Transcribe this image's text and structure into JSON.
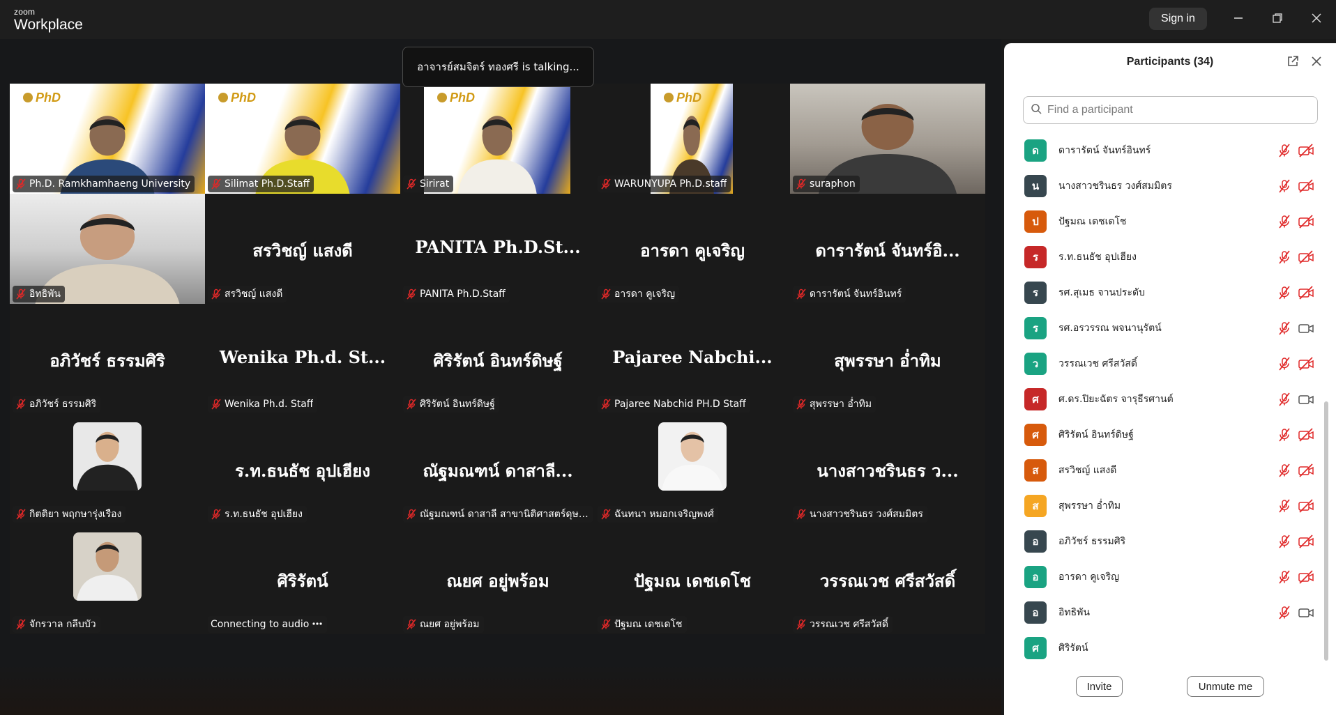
{
  "app": {
    "brand_top": "zoom",
    "brand_main": "Workplace",
    "signin_label": "Sign in"
  },
  "toast": {
    "text": "อาจารย์สมจิตร์  ทองศรี is talking..."
  },
  "tiles": [
    {
      "label": "Ph.D. Ramkhamhaeng University",
      "type": "video",
      "video": "phd",
      "muted": true
    },
    {
      "label": "Silimat Ph.D.Staff",
      "type": "video",
      "video": "phd",
      "muted": true
    },
    {
      "label": "Sirirat",
      "type": "video",
      "video": "phd",
      "muted": true
    },
    {
      "label": "WARUNYUPA Ph.D.staff",
      "type": "video",
      "video": "phd",
      "muted": true
    },
    {
      "label": "suraphon",
      "type": "video",
      "video": "office",
      "muted": true
    },
    {
      "label": "อิทธิพัน",
      "type": "video",
      "video": "room",
      "muted": true
    },
    {
      "big": "สรวิชญ์  แสงดี",
      "label": "สรวิชญ์  แสงดี",
      "type": "name",
      "muted": true
    },
    {
      "big": "PANITA  Ph.D.St...",
      "label": "PANITA Ph.D.Staff",
      "type": "name",
      "muted": true
    },
    {
      "big": "อารดา คูเจริญ",
      "label": "อารดา คูเจริญ",
      "type": "name",
      "muted": true
    },
    {
      "big": "ดารารัตน์ จันทร์อิ...",
      "label": "ดารารัตน์ จันทร์อินทร์",
      "type": "name",
      "muted": true
    },
    {
      "big": "อภิวัชร์ ธรรมศิริ",
      "label": "อภิวัชร์ ธรรมศิริ",
      "type": "name",
      "muted": true
    },
    {
      "big": "Wenika  Ph.d.  St...",
      "label": "Wenika Ph.d. Staff",
      "type": "name",
      "muted": true
    },
    {
      "big": "ศิริรัตน์ อินทร์ดิษฐ์",
      "label": "ศิริรัตน์ อินทร์ดิษฐ์",
      "type": "name",
      "muted": true
    },
    {
      "big": "Pajaree  Nabchi...",
      "label": "Pajaree Nabchid PH.D Staff",
      "type": "name",
      "muted": true
    },
    {
      "big": "สุพรรษา อ่ำทิม",
      "label": "สุพรรษา อ่ำทิม",
      "type": "name",
      "muted": true
    },
    {
      "label": "กิตติยา พฤกษารุ่งเรือง",
      "type": "avatar",
      "avatar": "woman-suit",
      "muted": true
    },
    {
      "big": "ร.ท.ธนธัช  อุปเฮียง",
      "label": "ร.ท.ธนธัช  อุปเฮียง",
      "type": "name",
      "muted": true
    },
    {
      "big": "ณัฐมณฑน์ ดาสาลี...",
      "label": "ณัฐมณฑน์ ดาสาลี สาขานิติศาสตร์ดุษฎี...",
      "type": "name",
      "muted": true
    },
    {
      "label": "ฉันทนา หมอกเจริญพงศ์",
      "type": "avatar",
      "avatar": "woman-white",
      "muted": true
    },
    {
      "big": "นางสาวชรินธร ว...",
      "label": "นางสาวชรินธร วงศ์สมมิตร",
      "type": "name",
      "muted": true
    },
    {
      "label": "จักรวาล กลีบบัว",
      "type": "avatar",
      "avatar": "group",
      "muted": true
    },
    {
      "big": "ศิริรัตน์",
      "label": "Connecting to audio",
      "type": "name",
      "muted": false,
      "connecting": true
    },
    {
      "big": "ณยศ อยู่พร้อม",
      "label": "ณยศ อยู่พร้อม",
      "type": "name",
      "muted": true
    },
    {
      "big": "ปัฐมณ เดชเดโช",
      "label": "ปัฐมณ เดชเดโช",
      "type": "name",
      "muted": true
    },
    {
      "big": "วรรณเวช ศรีสวัสดิ์",
      "label": "วรรณเวช ศรีสวัสดิ์",
      "type": "name",
      "muted": true
    }
  ],
  "panel": {
    "title": "Participants (34)",
    "search_placeholder": "Find a participant",
    "invite_label": "Invite",
    "unmute_label": "Unmute me",
    "participants": [
      {
        "initial": "ด",
        "color": "#1aa382",
        "name": "ดารารัตน์ จันทร์อินทร์",
        "mic": "muted",
        "cam": "off"
      },
      {
        "initial": "น",
        "color": "#37474f",
        "name": "นางสาวชรินธร วงศ์สมมิตร",
        "mic": "muted",
        "cam": "off"
      },
      {
        "initial": "ป",
        "color": "#d75a0c",
        "name": "ปัฐมณ เดชเดโช",
        "mic": "muted",
        "cam": "off"
      },
      {
        "initial": "ร",
        "color": "#c62828",
        "name": "ร.ท.ธนธัช  อุปเฮียง",
        "mic": "muted",
        "cam": "off"
      },
      {
        "initial": "ร",
        "color": "#37474f",
        "name": "รศ.สุเมธ  จานประดับ",
        "mic": "muted",
        "cam": "off"
      },
      {
        "initial": "ร",
        "color": "#1aa382",
        "name": "รศ.อรวรรณ พจนานุรัตน์",
        "mic": "muted",
        "cam": "on"
      },
      {
        "initial": "ว",
        "color": "#1aa382",
        "name": "วรรณเวช ศรีสวัสดิ์",
        "mic": "muted",
        "cam": "off"
      },
      {
        "initial": "ศ",
        "color": "#c62828",
        "name": "ศ.ดร.ปิยะฉัตร  จารุธีรศานต์",
        "mic": "muted",
        "cam": "on"
      },
      {
        "initial": "ศ",
        "color": "#d75a0c",
        "name": "ศิริรัตน์ อินทร์ดิษฐ์",
        "mic": "muted",
        "cam": "off"
      },
      {
        "initial": "ส",
        "color": "#d75a0c",
        "name": "สรวิชญ์  แสงดี",
        "mic": "muted",
        "cam": "off"
      },
      {
        "initial": "ส",
        "color": "#f5a623",
        "name": "สุพรรษา อ่ำทิม",
        "mic": "muted",
        "cam": "off"
      },
      {
        "initial": "อ",
        "color": "#37474f",
        "name": "อภิวัชร์ ธรรมศิริ",
        "mic": "muted",
        "cam": "off"
      },
      {
        "initial": "อ",
        "color": "#1aa382",
        "name": "อารดา คูเจริญ",
        "mic": "muted",
        "cam": "off"
      },
      {
        "initial": "อ",
        "color": "#37474f",
        "name": "อิทธิพัน",
        "mic": "muted",
        "cam": "on"
      },
      {
        "initial": "ศ",
        "color": "#1aa382",
        "name": "ศิริรัตน์",
        "mic": "none",
        "cam": "none"
      }
    ]
  }
}
